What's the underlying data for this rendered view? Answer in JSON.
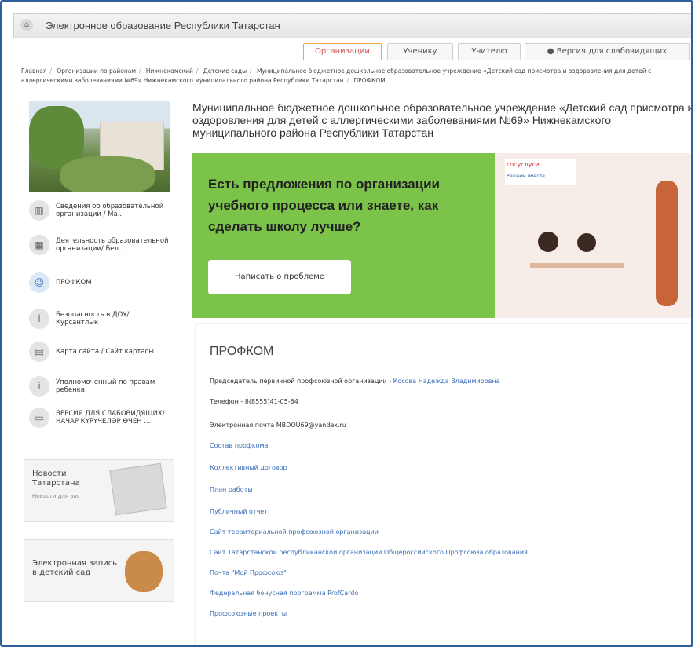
{
  "header": {
    "title": "Электронное образование Республики Татарстан"
  },
  "topnav": {
    "items": [
      "Организации",
      "Ученику",
      "Учителю",
      "Версия для слабовидящих"
    ]
  },
  "breadcrumbs": [
    "Главная",
    "Организации по районам",
    "Нижнекамский",
    "Детские сады",
    "Муниципальное бюджетное дошкольное образовательное учреждение «Детский сад присмотра и оздоровления для детей с аллергическими заболеваниями №69» Нижнекамского муниципального района Республики Татарстан",
    "ПРОФКОМ"
  ],
  "sidebar": {
    "items": [
      {
        "label": "Сведения об образовательной организации / Ма...",
        "icon": "building-icon"
      },
      {
        "label": "Деятельность образовательной организации/ Бел...",
        "icon": "school-icon"
      },
      {
        "label": "ПРОФКОМ",
        "icon": "people-icon"
      },
      {
        "label": "Безопасность в ДОУ/ Курсантлык",
        "icon": "info-icon"
      },
      {
        "label": "Карта сайта / Сайт картасы",
        "icon": "sitemap-icon"
      },
      {
        "label": "Уполномоченный по правам ребенка",
        "icon": "info-icon"
      },
      {
        "label": "ВЕРСИЯ ДЛЯ СЛАБОВИДЯЩИХ/НАЧАР КҮРҮЧЕЛӘР ӨЧЕН ...",
        "icon": "monitor-icon"
      }
    ]
  },
  "news": {
    "title": "Новости Татарстана",
    "subtitle": "Новости для вас"
  },
  "enroll": {
    "title": "Электронная запись в детский сад"
  },
  "org": {
    "title": "Муниципальное бюджетное дошкольное образовательное учреждение «Детский сад присмотра и оздоровления для детей с аллергическими заболеваниями №69» Нижнекамского муниципального района Республики Татарстан"
  },
  "banner": {
    "question": "Есть предложения по организации учебного процесса или знаете, как сделать школу лучше?",
    "button": "Написать о проблеме",
    "gos_logo": "госуслуги",
    "gos_sub": "Решаем вместе"
  },
  "content": {
    "heading": "ПРОФКОМ",
    "chair_label": "Председатель первичной профсоюзной организации - ",
    "chair_name": "Косова Надежда Владимировна",
    "phone": "Телефон - 8(8555)41-05-64",
    "email": "Электронная почта MBDOU69@yandex.ru",
    "links": [
      "Состав профкома",
      "Коллективный договор",
      "План работы",
      "Публичный отчет",
      "Сайт территориальной профсоюзной организации",
      "Сайт Татарстанской республиканской организации Общероссийского Профсоюза образования",
      "Почта \"Мой Профсоюз\"",
      "Федеральная бонусная программа ProfCardo",
      "Профсоюзные проекты"
    ]
  }
}
